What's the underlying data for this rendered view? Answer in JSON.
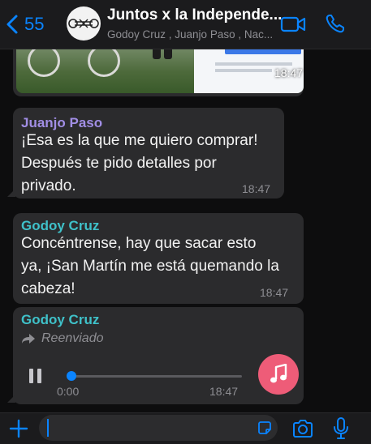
{
  "header": {
    "back_count": "55",
    "title": "Juntos x la Independe...",
    "subtitle": "Godoy Cruz , Juanjo Paso , Nac..."
  },
  "messages": [
    {
      "type": "image",
      "time": "18:47"
    },
    {
      "type": "text",
      "sender": "Juanjo Paso",
      "sender_color": "#a18ee5",
      "text": "¡Esa es la que me quiero comprar!\nDespués te pido detalles por\nprivado.",
      "time": "18:47"
    },
    {
      "type": "text",
      "sender": "Godoy Cruz",
      "sender_color": "#3fc1c9",
      "text": "Concéntrense, hay que sacar esto\nya, ¡San Martín me está quemando la\ncabeza!",
      "time": "18:47"
    },
    {
      "type": "audio",
      "sender": "Godoy Cruz",
      "sender_color": "#3fc1c9",
      "forwarded_label": "Reenviado",
      "elapsed": "0:00",
      "time": "18:47",
      "progress": 0.02
    }
  ],
  "colors": {
    "accent": "#0a84ff",
    "audio_button": "#ee5c78"
  },
  "icons": [
    "back-chevron-icon",
    "video-camera-icon",
    "phone-icon",
    "forward-arrow-icon",
    "pause-icon",
    "music-note-icon",
    "plus-icon",
    "sticker-icon",
    "camera-icon",
    "microphone-icon"
  ]
}
